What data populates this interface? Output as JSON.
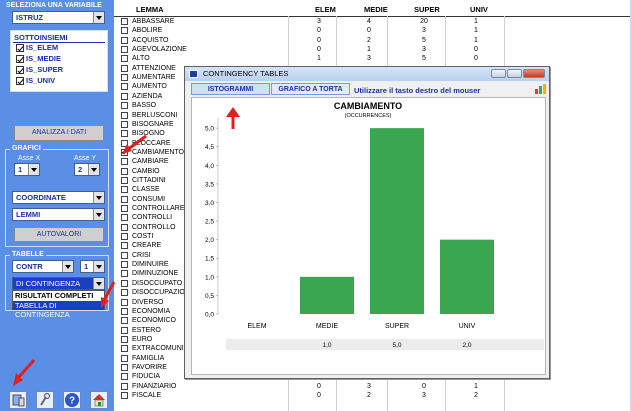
{
  "left_panel": {
    "variable_label": "SELEZIONA UNA VARIABILE",
    "variable_value": "ISTRUZ",
    "subsets_label": "SOTTOINSIEMI",
    "subsets": [
      {
        "label": "IS_ELEM",
        "checked": true
      },
      {
        "label": "IS_MEDIE",
        "checked": true
      },
      {
        "label": "IS_SUPER",
        "checked": true
      },
      {
        "label": "IS_UNIV",
        "checked": true
      }
    ],
    "analyze_button": "ANALIZZA I DATI",
    "grafici_label": "GRAFICI",
    "axis_x_label": "Asse X",
    "axis_y_label": "Asse Y",
    "axis_x_value": "1",
    "axis_y_value": "2",
    "coord_value": "COORDINATE",
    "lemmi_value": "LEMMI",
    "autovalori_button": "AUTOVALORI",
    "tabelle_label": "TABELLE",
    "contr_value": "CONTR",
    "contr_num": "1",
    "dropdown_selected": "DI CONTINGENZA",
    "dropdown_options": [
      "RISULTATI COMPLETI",
      "TABELLA DI CONTINGENZA"
    ]
  },
  "table": {
    "headers": [
      "LEMMA",
      "ELEM",
      "MEDIE",
      "SUPER",
      "UNIV"
    ],
    "rows": [
      {
        "lemma": "ABBASSARE",
        "checked": false,
        "v": [
          "3",
          "4",
          "20",
          "1"
        ]
      },
      {
        "lemma": "ABOLIRE",
        "checked": false,
        "v": [
          "0",
          "0",
          "3",
          "1"
        ]
      },
      {
        "lemma": "ACQUISTO",
        "checked": false,
        "v": [
          "0",
          "2",
          "5",
          "1"
        ]
      },
      {
        "lemma": "AGEVOLAZIONE",
        "checked": false,
        "v": [
          "0",
          "1",
          "3",
          "0"
        ]
      },
      {
        "lemma": "ALTO",
        "checked": false,
        "v": [
          "1",
          "3",
          "5",
          "0"
        ]
      },
      {
        "lemma": "ATTENZIONE",
        "checked": false,
        "v": []
      },
      {
        "lemma": "AUMENTARE",
        "checked": false,
        "v": []
      },
      {
        "lemma": "AUMENTO",
        "checked": false,
        "v": []
      },
      {
        "lemma": "AZIENDA",
        "checked": false,
        "v": []
      },
      {
        "lemma": "BASSO",
        "checked": false,
        "v": []
      },
      {
        "lemma": "BERLUSCONI",
        "checked": false,
        "v": []
      },
      {
        "lemma": "BISOGNARE",
        "checked": false,
        "v": []
      },
      {
        "lemma": "BISOGNO",
        "checked": false,
        "v": []
      },
      {
        "lemma": "BLOCCARE",
        "checked": false,
        "v": []
      },
      {
        "lemma": "CAMBIAMENTO",
        "checked": true,
        "v": []
      },
      {
        "lemma": "CAMBIARE",
        "checked": false,
        "v": []
      },
      {
        "lemma": "CAMBIO",
        "checked": false,
        "v": []
      },
      {
        "lemma": "CITTADINI",
        "checked": false,
        "v": []
      },
      {
        "lemma": "CLASSE",
        "checked": false,
        "v": []
      },
      {
        "lemma": "CONSUMI",
        "checked": false,
        "v": []
      },
      {
        "lemma": "CONTROLLARE",
        "checked": false,
        "v": []
      },
      {
        "lemma": "CONTROLLI",
        "checked": false,
        "v": []
      },
      {
        "lemma": "CONTROLLO",
        "checked": false,
        "v": []
      },
      {
        "lemma": "COSTI",
        "checked": false,
        "v": []
      },
      {
        "lemma": "CREARE",
        "checked": false,
        "v": []
      },
      {
        "lemma": "CRISI",
        "checked": false,
        "v": []
      },
      {
        "lemma": "DIMINUIRE",
        "checked": false,
        "v": []
      },
      {
        "lemma": "DIMINUZIONE",
        "checked": false,
        "v": []
      },
      {
        "lemma": "DISOCCUPATO",
        "checked": false,
        "v": []
      },
      {
        "lemma": "DISOCCUPAZIONE",
        "checked": false,
        "v": []
      },
      {
        "lemma": "DIVERSO",
        "checked": false,
        "v": []
      },
      {
        "lemma": "ECONOMIA",
        "checked": false,
        "v": []
      },
      {
        "lemma": "ECONOMICO",
        "checked": false,
        "v": []
      },
      {
        "lemma": "ESTERO",
        "checked": false,
        "v": []
      },
      {
        "lemma": "EURO",
        "checked": false,
        "v": []
      },
      {
        "lemma": "EXTRACOMUNITARI",
        "checked": false,
        "v": []
      },
      {
        "lemma": "FAMIGLIA",
        "checked": false,
        "v": []
      },
      {
        "lemma": "FAVORIRE",
        "checked": false,
        "v": []
      },
      {
        "lemma": "FIDUCIA",
        "checked": false,
        "v": []
      },
      {
        "lemma": "FINANZIARIO",
        "checked": false,
        "v": [
          "0",
          "3",
          "0",
          "1"
        ]
      },
      {
        "lemma": "FISCALE",
        "checked": false,
        "v": [
          "0",
          "2",
          "3",
          "2"
        ]
      }
    ]
  },
  "dialog": {
    "title": "CONTINGENCY TABLES",
    "tab_istogrammi": "ISTOGRAMMI",
    "tab_torta": "GRAFICO A TORTA",
    "hint": "Utilizzare il tasto destro del mouser"
  },
  "chart_data": {
    "type": "bar",
    "title": "CAMBIAMENTO",
    "subtitle": "(OCCURRENCES)",
    "categories": [
      "ELEM",
      "MEDIE",
      "SUPER",
      "UNIV"
    ],
    "values": [
      0,
      1,
      5,
      2
    ],
    "value_labels": [
      "",
      "1,0",
      "5,0",
      "2,0"
    ],
    "y_ticks": [
      "0,0",
      "0,5",
      "1,0",
      "1,5",
      "2,0",
      "2,5",
      "3,0",
      "3,5",
      "4,0",
      "4,5",
      "5,0"
    ],
    "ylim": [
      0,
      5.3
    ],
    "bar_color": "#3aa64f",
    "grid": false
  },
  "colors": {
    "panel_bg": "#5b8fe6",
    "label_blue": "#1b2fa8",
    "arrow_red": "#e02020"
  }
}
